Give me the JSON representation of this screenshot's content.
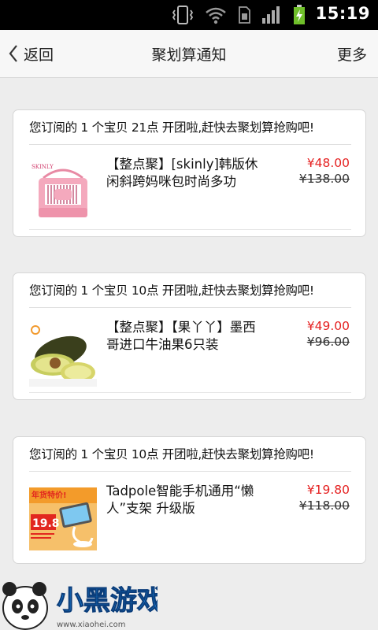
{
  "status_bar": {
    "time": "15:19"
  },
  "header": {
    "back_label": "返回",
    "title": "聚划算通知",
    "more_label": "更多"
  },
  "notifications": [
    {
      "heading": "您订阅的 1 个宝贝 21点 开团啦,赶快去聚划算抢购吧!",
      "product_title": "【整点聚】[skinly]韩版休闲斜跨妈咪包时尚多功",
      "price": "¥48.00",
      "original_price": "¥138.00",
      "brand_mark": "SKINLY"
    },
    {
      "heading": "您订阅的 1 个宝贝 10点 开团啦,赶快去聚划算抢购吧!",
      "product_title": "【整点聚】【果丫丫】墨西哥进口牛油果6只装",
      "price": "¥49.00",
      "original_price": "¥96.00"
    },
    {
      "heading": "您订阅的 1 个宝贝 10点 开团啦,赶快去聚划算抢购吧!",
      "product_title": "Tadpole智能手机通用“懒人”支架 升级版",
      "price": "¥19.80",
      "original_price": "¥118.00",
      "banner_text": "年货特价!",
      "banner_price": "19.8"
    }
  ],
  "watermark": {
    "logo_text": "小黑游戏",
    "url": "www.xiaohei.com"
  },
  "colors": {
    "price_red": "#e52222",
    "page_bg": "#ededed",
    "status_bar": "#000000"
  }
}
